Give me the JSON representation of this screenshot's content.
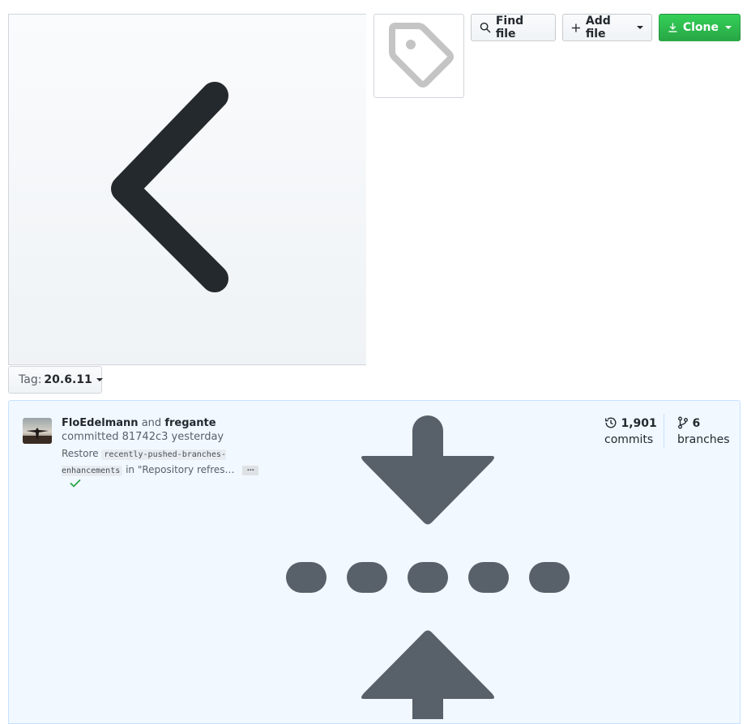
{
  "toolbar": {
    "find_file_label": "Find file",
    "add_file_label": "Add file",
    "clone_label": "Clone"
  },
  "branch_selector": {
    "prefix": "Tag:",
    "value": "20.6.11"
  },
  "commit": {
    "author1": "FloEdelmann",
    "and_text": "and",
    "author2": "fregante",
    "committed_text": "committed 81742c3 yesterday",
    "message_prefix": "Restore",
    "message_code": "recently-pushed-branches-enhancements",
    "message_suffix": "in \"Repository refres…",
    "ellipsis": "…",
    "status": "success"
  },
  "stats": {
    "commits_count": "1,901",
    "commits_label": "commits",
    "branches_count": "6",
    "branches_label": "branches"
  },
  "colors": {
    "clone_green": "#28a745",
    "commit_bg": "#f1f8ff",
    "check_green": "#28a745",
    "icon_dark": "#24292e",
    "icon_slate": "#586069"
  },
  "icons": [
    "chevron-left-icon",
    "tag-icon",
    "search-icon",
    "plus-icon",
    "download-icon",
    "history-icon",
    "git-branch-icon",
    "check-icon",
    "unfold-icon"
  ]
}
